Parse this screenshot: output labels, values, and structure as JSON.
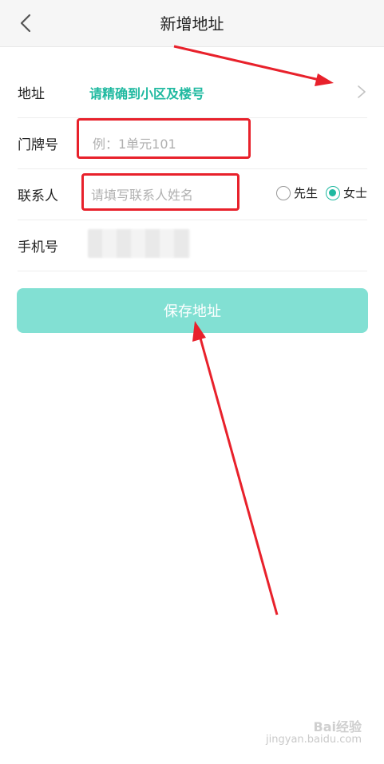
{
  "header": {
    "title": "新增地址"
  },
  "form": {
    "address": {
      "label": "地址",
      "link_text": "请精确到小区及楼号"
    },
    "door": {
      "label": "门牌号",
      "placeholder": "例：1单元101"
    },
    "contact": {
      "label": "联系人",
      "placeholder": "请填写联系人姓名",
      "options": [
        {
          "label": "先生",
          "selected": false
        },
        {
          "label": "女士",
          "selected": true
        }
      ]
    },
    "phone": {
      "label": "手机号"
    }
  },
  "actions": {
    "save_label": "保存地址"
  },
  "watermark": {
    "brand": "Bai经验",
    "url": "jingyan.baidu.com"
  },
  "colors": {
    "accent": "#1fb9a0",
    "button": "#82e0d3",
    "annotation": "#e8212b"
  },
  "icons": [
    "back-arrow-icon",
    "chevron-right-icon",
    "radio-icon"
  ]
}
